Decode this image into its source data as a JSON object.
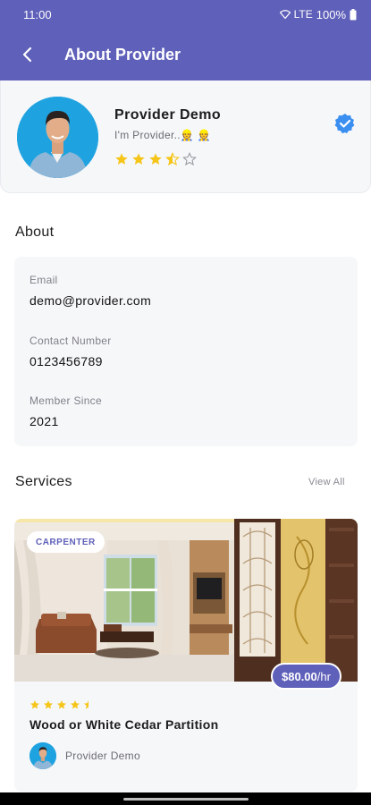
{
  "status_bar": {
    "time": "11:00",
    "network": "LTE",
    "battery": "100%"
  },
  "appbar": {
    "title": "About Provider"
  },
  "provider": {
    "name": "Provider Demo",
    "tagline": "I'm Provider..👷 👷",
    "rating": 3.5,
    "verified": true
  },
  "about": {
    "title": "About",
    "fields": [
      {
        "label": "Email",
        "value": "demo@provider.com"
      },
      {
        "label": "Contact Number",
        "value": "0123456789"
      },
      {
        "label": "Member Since",
        "value": "2021"
      }
    ]
  },
  "services": {
    "title": "Services",
    "view_all": "View All",
    "items": [
      {
        "category": "CARPENTER",
        "price": "$80.00",
        "price_unit": "/hr",
        "rating": 4.5,
        "name": "Wood or White Cedar Partition",
        "provider_name": "Provider Demo"
      }
    ]
  },
  "colors": {
    "primary": "#5f60b9",
    "star": "#f5c518",
    "card_bg": "#f6f7f9",
    "verified": "#3a8ff0"
  }
}
